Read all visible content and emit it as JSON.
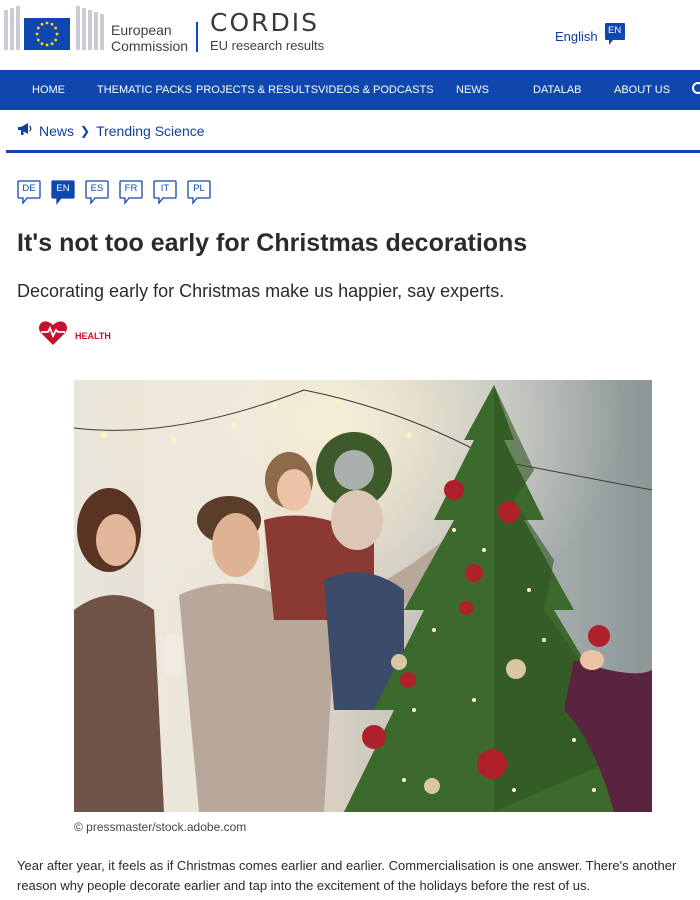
{
  "header": {
    "org_line1": "European",
    "org_line2": "Commission",
    "site_name": "CORDIS",
    "site_tagline": "EU research results",
    "language_label": "English",
    "language_code": "EN"
  },
  "nav": {
    "items": [
      "HOME",
      "THEMATIC PACKS",
      "PROJECTS & RESULTS",
      "VIDEOS & PODCASTS",
      "NEWS",
      "DATALAB",
      "ABOUT US"
    ]
  },
  "breadcrumb": {
    "section": "News",
    "subsection": "Trending Science"
  },
  "languages": {
    "available": [
      "DE",
      "EN",
      "ES",
      "FR",
      "IT",
      "PL"
    ],
    "active": "EN"
  },
  "article": {
    "title": "It's not too early for Christmas decorations",
    "subtitle": "Decorating early for Christmas make us happier, say experts.",
    "category": "HEALTH",
    "image_credit": "© pressmaster/stock.adobe.com",
    "intro": "Year after year, it feels as if Christmas comes earlier and earlier. Commercialisation is one answer. There's another reason why people decorate earlier and tap into the excitement of the holidays before the rest of us."
  },
  "colors": {
    "brand_blue": "#0f47af",
    "link_blue": "#0f3f9e",
    "category_red": "#c8102e"
  }
}
